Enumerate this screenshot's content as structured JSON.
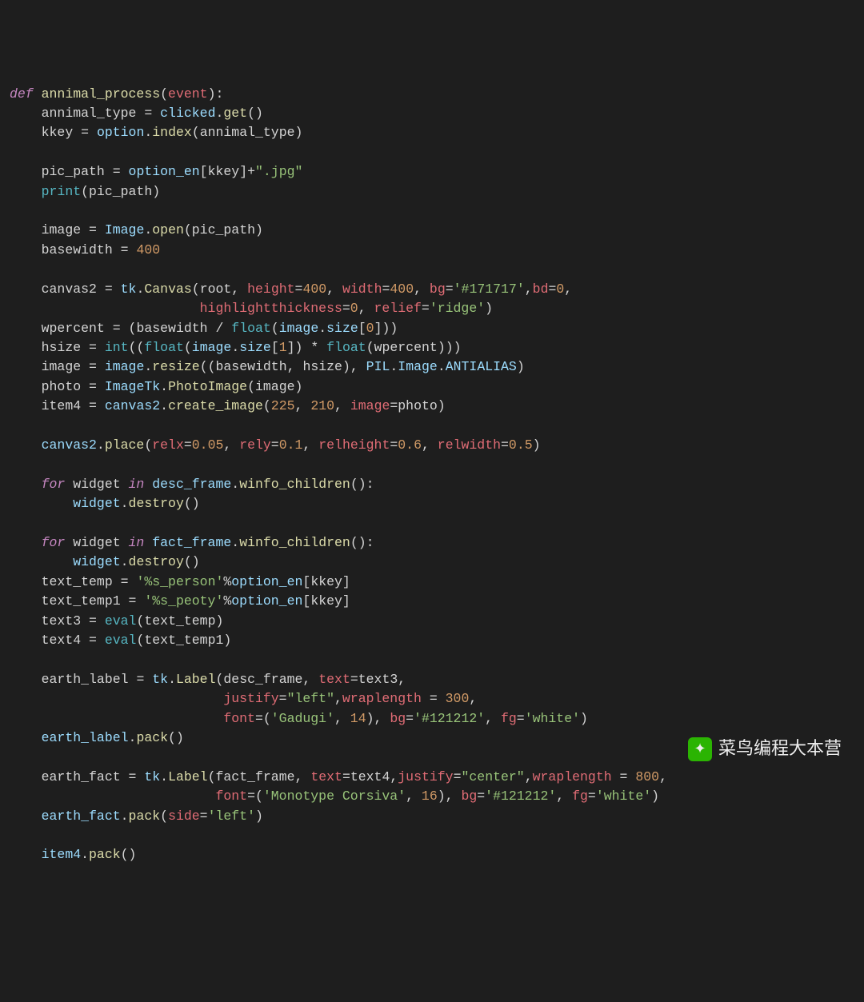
{
  "watermark": {
    "icon_glyph": "✦",
    "text": "菜鸟编程大本营"
  },
  "code": {
    "lines": [
      [
        [
          "kw",
          "def "
        ],
        [
          "fn",
          "annimal_process"
        ],
        [
          "pn",
          "("
        ],
        [
          "param",
          "event"
        ],
        [
          "pn",
          "):"
        ]
      ],
      [
        [
          "pn",
          "    "
        ],
        [
          "var",
          "annimal_type "
        ],
        [
          "op",
          "= "
        ],
        [
          "obj",
          "clicked"
        ],
        [
          "pn",
          "."
        ],
        [
          "fn",
          "get"
        ],
        [
          "pn",
          "()"
        ]
      ],
      [
        [
          "pn",
          "    "
        ],
        [
          "var",
          "kkey "
        ],
        [
          "op",
          "= "
        ],
        [
          "obj",
          "option"
        ],
        [
          "pn",
          "."
        ],
        [
          "fn",
          "index"
        ],
        [
          "pn",
          "("
        ],
        [
          "var",
          "annimal_type"
        ],
        [
          "pn",
          ")"
        ]
      ],
      [],
      [
        [
          "pn",
          "    "
        ],
        [
          "var",
          "pic_path "
        ],
        [
          "op",
          "= "
        ],
        [
          "obj",
          "option_en"
        ],
        [
          "pn",
          "["
        ],
        [
          "var",
          "kkey"
        ],
        [
          "pn",
          "]"
        ],
        [
          "op",
          "+"
        ],
        [
          "str",
          "\".jpg\""
        ]
      ],
      [
        [
          "pn",
          "    "
        ],
        [
          "fn2",
          "print"
        ],
        [
          "pn",
          "("
        ],
        [
          "var",
          "pic_path"
        ],
        [
          "pn",
          ")"
        ]
      ],
      [],
      [
        [
          "pn",
          "    "
        ],
        [
          "var",
          "image "
        ],
        [
          "op",
          "= "
        ],
        [
          "obj",
          "Image"
        ],
        [
          "pn",
          "."
        ],
        [
          "fn",
          "open"
        ],
        [
          "pn",
          "("
        ],
        [
          "var",
          "pic_path"
        ],
        [
          "pn",
          ")"
        ]
      ],
      [
        [
          "pn",
          "    "
        ],
        [
          "var",
          "basewidth "
        ],
        [
          "op",
          "= "
        ],
        [
          "num",
          "400"
        ]
      ],
      [],
      [
        [
          "pn",
          "    "
        ],
        [
          "var",
          "canvas2 "
        ],
        [
          "op",
          "= "
        ],
        [
          "obj",
          "tk"
        ],
        [
          "pn",
          "."
        ],
        [
          "fn",
          "Canvas"
        ],
        [
          "pn",
          "("
        ],
        [
          "var",
          "root"
        ],
        [
          "pn",
          ", "
        ],
        [
          "kwarg",
          "height"
        ],
        [
          "op",
          "="
        ],
        [
          "num",
          "400"
        ],
        [
          "pn",
          ", "
        ],
        [
          "kwarg",
          "width"
        ],
        [
          "op",
          "="
        ],
        [
          "num",
          "400"
        ],
        [
          "pn",
          ", "
        ],
        [
          "kwarg",
          "bg"
        ],
        [
          "op",
          "="
        ],
        [
          "str",
          "'#171717'"
        ],
        [
          "pn",
          ","
        ],
        [
          "kwarg",
          "bd"
        ],
        [
          "op",
          "="
        ],
        [
          "num",
          "0"
        ],
        [
          "pn",
          ","
        ]
      ],
      [
        [
          "pn",
          "                        "
        ],
        [
          "kwarg",
          "highlightthickness"
        ],
        [
          "op",
          "="
        ],
        [
          "num",
          "0"
        ],
        [
          "pn",
          ", "
        ],
        [
          "kwarg",
          "relief"
        ],
        [
          "op",
          "="
        ],
        [
          "str",
          "'ridge'"
        ],
        [
          "pn",
          ")"
        ]
      ],
      [
        [
          "pn",
          "    "
        ],
        [
          "var",
          "wpercent "
        ],
        [
          "op",
          "= "
        ],
        [
          "pn",
          "("
        ],
        [
          "var",
          "basewidth "
        ],
        [
          "op",
          "/ "
        ],
        [
          "fn2",
          "float"
        ],
        [
          "pn",
          "("
        ],
        [
          "obj",
          "image"
        ],
        [
          "pn",
          "."
        ],
        [
          "prop",
          "size"
        ],
        [
          "pn",
          "["
        ],
        [
          "num",
          "0"
        ],
        [
          "pn",
          "]))"
        ]
      ],
      [
        [
          "pn",
          "    "
        ],
        [
          "var",
          "hsize "
        ],
        [
          "op",
          "= "
        ],
        [
          "fn2",
          "int"
        ],
        [
          "pn",
          "(("
        ],
        [
          "fn2",
          "float"
        ],
        [
          "pn",
          "("
        ],
        [
          "obj",
          "image"
        ],
        [
          "pn",
          "."
        ],
        [
          "prop",
          "size"
        ],
        [
          "pn",
          "["
        ],
        [
          "num",
          "1"
        ],
        [
          "pn",
          "]) "
        ],
        [
          "op",
          "* "
        ],
        [
          "fn2",
          "float"
        ],
        [
          "pn",
          "("
        ],
        [
          "var",
          "wpercent"
        ],
        [
          "pn",
          ")))"
        ]
      ],
      [
        [
          "pn",
          "    "
        ],
        [
          "var",
          "image "
        ],
        [
          "op",
          "= "
        ],
        [
          "obj",
          "image"
        ],
        [
          "pn",
          "."
        ],
        [
          "fn",
          "resize"
        ],
        [
          "pn",
          "(("
        ],
        [
          "var",
          "basewidth"
        ],
        [
          "pn",
          ", "
        ],
        [
          "var",
          "hsize"
        ],
        [
          "pn",
          "), "
        ],
        [
          "obj",
          "PIL"
        ],
        [
          "pn",
          "."
        ],
        [
          "obj",
          "Image"
        ],
        [
          "pn",
          "."
        ],
        [
          "prop",
          "ANTIALIAS"
        ],
        [
          "pn",
          ")"
        ]
      ],
      [
        [
          "pn",
          "    "
        ],
        [
          "var",
          "photo "
        ],
        [
          "op",
          "= "
        ],
        [
          "obj",
          "ImageTk"
        ],
        [
          "pn",
          "."
        ],
        [
          "fn",
          "PhotoImage"
        ],
        [
          "pn",
          "("
        ],
        [
          "var",
          "image"
        ],
        [
          "pn",
          ")"
        ]
      ],
      [
        [
          "pn",
          "    "
        ],
        [
          "var",
          "item4 "
        ],
        [
          "op",
          "= "
        ],
        [
          "obj",
          "canvas2"
        ],
        [
          "pn",
          "."
        ],
        [
          "fn",
          "create_image"
        ],
        [
          "pn",
          "("
        ],
        [
          "num",
          "225"
        ],
        [
          "pn",
          ", "
        ],
        [
          "num",
          "210"
        ],
        [
          "pn",
          ", "
        ],
        [
          "kwarg",
          "image"
        ],
        [
          "op",
          "="
        ],
        [
          "var",
          "photo"
        ],
        [
          "pn",
          ")"
        ]
      ],
      [],
      [
        [
          "pn",
          "    "
        ],
        [
          "obj",
          "canvas2"
        ],
        [
          "pn",
          "."
        ],
        [
          "fn",
          "place"
        ],
        [
          "pn",
          "("
        ],
        [
          "kwarg",
          "relx"
        ],
        [
          "op",
          "="
        ],
        [
          "num",
          "0.05"
        ],
        [
          "pn",
          ", "
        ],
        [
          "kwarg",
          "rely"
        ],
        [
          "op",
          "="
        ],
        [
          "num",
          "0.1"
        ],
        [
          "pn",
          ", "
        ],
        [
          "kwarg",
          "relheight"
        ],
        [
          "op",
          "="
        ],
        [
          "num",
          "0.6"
        ],
        [
          "pn",
          ", "
        ],
        [
          "kwarg",
          "relwidth"
        ],
        [
          "op",
          "="
        ],
        [
          "num",
          "0.5"
        ],
        [
          "pn",
          ")"
        ]
      ],
      [],
      [
        [
          "pn",
          "    "
        ],
        [
          "kw",
          "for "
        ],
        [
          "var",
          "widget "
        ],
        [
          "kw",
          "in "
        ],
        [
          "obj",
          "desc_frame"
        ],
        [
          "pn",
          "."
        ],
        [
          "fn",
          "winfo_children"
        ],
        [
          "pn",
          "():"
        ]
      ],
      [
        [
          "pn",
          "        "
        ],
        [
          "obj",
          "widget"
        ],
        [
          "pn",
          "."
        ],
        [
          "fn",
          "destroy"
        ],
        [
          "pn",
          "()"
        ]
      ],
      [],
      [
        [
          "pn",
          "    "
        ],
        [
          "kw",
          "for "
        ],
        [
          "var",
          "widget "
        ],
        [
          "kw",
          "in "
        ],
        [
          "obj",
          "fact_frame"
        ],
        [
          "pn",
          "."
        ],
        [
          "fn",
          "winfo_children"
        ],
        [
          "pn",
          "():"
        ]
      ],
      [
        [
          "pn",
          "        "
        ],
        [
          "obj",
          "widget"
        ],
        [
          "pn",
          "."
        ],
        [
          "fn",
          "destroy"
        ],
        [
          "pn",
          "()"
        ]
      ],
      [
        [
          "pn",
          "    "
        ],
        [
          "var",
          "text_temp "
        ],
        [
          "op",
          "= "
        ],
        [
          "str",
          "'%s_person'"
        ],
        [
          "op",
          "%"
        ],
        [
          "obj",
          "option_en"
        ],
        [
          "pn",
          "["
        ],
        [
          "var",
          "kkey"
        ],
        [
          "pn",
          "]"
        ]
      ],
      [
        [
          "pn",
          "    "
        ],
        [
          "var",
          "text_temp1 "
        ],
        [
          "op",
          "= "
        ],
        [
          "str",
          "'%s_peoty'"
        ],
        [
          "op",
          "%"
        ],
        [
          "obj",
          "option_en"
        ],
        [
          "pn",
          "["
        ],
        [
          "var",
          "kkey"
        ],
        [
          "pn",
          "]"
        ]
      ],
      [
        [
          "pn",
          "    "
        ],
        [
          "var",
          "text3 "
        ],
        [
          "op",
          "= "
        ],
        [
          "fn2",
          "eval"
        ],
        [
          "pn",
          "("
        ],
        [
          "var",
          "text_temp"
        ],
        [
          "pn",
          ")"
        ]
      ],
      [
        [
          "pn",
          "    "
        ],
        [
          "var",
          "text4 "
        ],
        [
          "op",
          "= "
        ],
        [
          "fn2",
          "eval"
        ],
        [
          "pn",
          "("
        ],
        [
          "var",
          "text_temp1"
        ],
        [
          "pn",
          ")"
        ]
      ],
      [],
      [
        [
          "pn",
          "    "
        ],
        [
          "var",
          "earth_label "
        ],
        [
          "op",
          "= "
        ],
        [
          "obj",
          "tk"
        ],
        [
          "pn",
          "."
        ],
        [
          "fn",
          "Label"
        ],
        [
          "pn",
          "("
        ],
        [
          "var",
          "desc_frame"
        ],
        [
          "pn",
          ", "
        ],
        [
          "kwarg",
          "text"
        ],
        [
          "op",
          "="
        ],
        [
          "var",
          "text3"
        ],
        [
          "pn",
          ","
        ]
      ],
      [
        [
          "pn",
          "                           "
        ],
        [
          "kwarg",
          "justify"
        ],
        [
          "op",
          "="
        ],
        [
          "str",
          "\"left\""
        ],
        [
          "pn",
          ","
        ],
        [
          "kwarg",
          "wraplength"
        ],
        [
          "op",
          " = "
        ],
        [
          "num",
          "300"
        ],
        [
          "pn",
          ","
        ]
      ],
      [
        [
          "pn",
          "                           "
        ],
        [
          "kwarg",
          "font"
        ],
        [
          "op",
          "="
        ],
        [
          "pn",
          "("
        ],
        [
          "str",
          "'Gadugi'"
        ],
        [
          "pn",
          ", "
        ],
        [
          "num",
          "14"
        ],
        [
          "pn",
          "), "
        ],
        [
          "kwarg",
          "bg"
        ],
        [
          "op",
          "="
        ],
        [
          "str",
          "'#121212'"
        ],
        [
          "pn",
          ", "
        ],
        [
          "kwarg",
          "fg"
        ],
        [
          "op",
          "="
        ],
        [
          "str",
          "'white'"
        ],
        [
          "pn",
          ")"
        ]
      ],
      [
        [
          "pn",
          "    "
        ],
        [
          "obj",
          "earth_label"
        ],
        [
          "pn",
          "."
        ],
        [
          "fn",
          "pack"
        ],
        [
          "pn",
          "()"
        ]
      ],
      [],
      [
        [
          "pn",
          "    "
        ],
        [
          "var",
          "earth_fact "
        ],
        [
          "op",
          "= "
        ],
        [
          "obj",
          "tk"
        ],
        [
          "pn",
          "."
        ],
        [
          "fn",
          "Label"
        ],
        [
          "pn",
          "("
        ],
        [
          "var",
          "fact_frame"
        ],
        [
          "pn",
          ", "
        ],
        [
          "kwarg",
          "text"
        ],
        [
          "op",
          "="
        ],
        [
          "var",
          "text4"
        ],
        [
          "pn",
          ","
        ],
        [
          "kwarg",
          "justify"
        ],
        [
          "op",
          "="
        ],
        [
          "str",
          "\"center\""
        ],
        [
          "pn",
          ","
        ],
        [
          "kwarg",
          "wraplength"
        ],
        [
          "op",
          " = "
        ],
        [
          "num",
          "800"
        ],
        [
          "pn",
          ","
        ]
      ],
      [
        [
          "pn",
          "                          "
        ],
        [
          "kwarg",
          "font"
        ],
        [
          "op",
          "="
        ],
        [
          "pn",
          "("
        ],
        [
          "str",
          "'Monotype Corsiva'"
        ],
        [
          "pn",
          ", "
        ],
        [
          "num",
          "16"
        ],
        [
          "pn",
          "), "
        ],
        [
          "kwarg",
          "bg"
        ],
        [
          "op",
          "="
        ],
        [
          "str",
          "'#121212'"
        ],
        [
          "pn",
          ", "
        ],
        [
          "kwarg",
          "fg"
        ],
        [
          "op",
          "="
        ],
        [
          "str",
          "'white'"
        ],
        [
          "pn",
          ")"
        ]
      ],
      [
        [
          "pn",
          "    "
        ],
        [
          "obj",
          "earth_fact"
        ],
        [
          "pn",
          "."
        ],
        [
          "fn",
          "pack"
        ],
        [
          "pn",
          "("
        ],
        [
          "kwarg",
          "side"
        ],
        [
          "op",
          "="
        ],
        [
          "str",
          "'left'"
        ],
        [
          "pn",
          ")"
        ]
      ],
      [],
      [
        [
          "pn",
          "    "
        ],
        [
          "obj",
          "item4"
        ],
        [
          "pn",
          "."
        ],
        [
          "fn",
          "pack"
        ],
        [
          "pn",
          "()"
        ]
      ]
    ]
  }
}
